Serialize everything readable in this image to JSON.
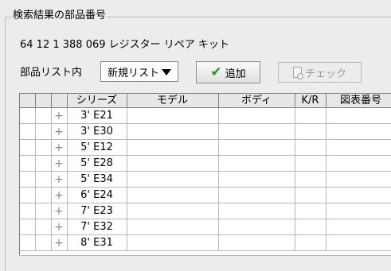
{
  "group": {
    "title": "検索結果の部品番号"
  },
  "part": {
    "line": "64 12 1 388 069 レジスター リペア キット"
  },
  "controls": {
    "list_label": "部品リスト内",
    "combo_value": "新規リスト",
    "add_label": "追加",
    "check_label": "チェック"
  },
  "table": {
    "headers": [
      "",
      "",
      "",
      "シリーズ",
      "モデル",
      "ボディ",
      "K/R",
      "図表番号"
    ],
    "rows": [
      {
        "plus": "+",
        "series": "3' E21"
      },
      {
        "plus": "+",
        "series": "3' E30"
      },
      {
        "plus": "+",
        "series": "5' E12"
      },
      {
        "plus": "+",
        "series": "5' E28"
      },
      {
        "plus": "+",
        "series": "5' E34"
      },
      {
        "plus": "+",
        "series": "6' E24"
      },
      {
        "plus": "+",
        "series": "7' E23"
      },
      {
        "plus": "+",
        "series": "7' E32"
      },
      {
        "plus": "+",
        "series": "8' E31"
      }
    ]
  }
}
